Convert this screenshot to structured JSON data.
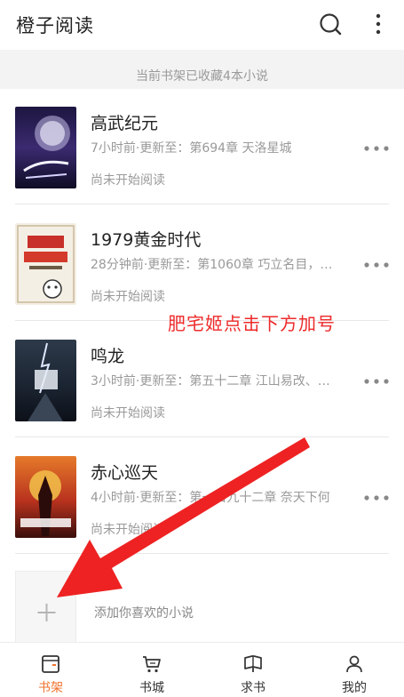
{
  "app": {
    "title": "橙子阅读"
  },
  "shelf": {
    "count_text": "当前书架已收藏4本小说",
    "books": [
      {
        "title": "高武纪元",
        "update": "7小时前·更新至：第694章 天洛星城",
        "status": "尚未开始阅读"
      },
      {
        "title": "1979黄金时代",
        "update": "28分钟前·更新至：第1060章 巧立名目，…",
        "status": "尚未开始阅读"
      },
      {
        "title": "鸣龙",
        "update": "3小时前·更新至：第五十二章 江山易改、…",
        "status": "尚未开始阅读"
      },
      {
        "title": "赤心巡天",
        "update": "4小时前·更新至：第一百九十二章 奈天下何",
        "status": "尚未开始阅读"
      }
    ],
    "add_label": "添加你喜欢的小说"
  },
  "annotation": {
    "text": "肥宅姬点击下方加号",
    "color": "#ee2a2a"
  },
  "tabs": [
    {
      "label": "书架",
      "icon": "bookshelf-icon",
      "active": true
    },
    {
      "label": "书城",
      "icon": "bookstore-cart-icon",
      "active": false
    },
    {
      "label": "求书",
      "icon": "request-book-icon",
      "active": false
    },
    {
      "label": "我的",
      "icon": "profile-icon",
      "active": false
    }
  ],
  "colors": {
    "accent": "#f0722c",
    "text": "#222222",
    "muted": "#999999",
    "strip": "#f3f3f3"
  }
}
